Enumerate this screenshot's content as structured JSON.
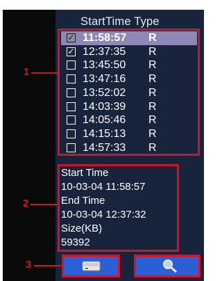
{
  "header": {
    "col_start": "StartTime",
    "col_type": "Type"
  },
  "files": [
    {
      "time": "11:58:57",
      "type": "R",
      "checked": true,
      "selected": true
    },
    {
      "time": "12:37:35",
      "type": "R",
      "checked": true,
      "selected": false
    },
    {
      "time": "13:45:50",
      "type": "R",
      "checked": false,
      "selected": false
    },
    {
      "time": "13:47:16",
      "type": "R",
      "checked": false,
      "selected": false
    },
    {
      "time": "13:52:02",
      "type": "R",
      "checked": false,
      "selected": false
    },
    {
      "time": "14:03:39",
      "type": "R",
      "checked": false,
      "selected": false
    },
    {
      "time": "14:05:46",
      "type": "R",
      "checked": false,
      "selected": false
    },
    {
      "time": "14:15:13",
      "type": "R",
      "checked": false,
      "selected": false
    },
    {
      "time": "14:57:33",
      "type": "R",
      "checked": false,
      "selected": false
    }
  ],
  "info": {
    "start_label": "Start Time",
    "start_value": "10-03-04 11:58:57",
    "end_label": "End Time",
    "end_value": "10-03-04 12:37:32",
    "size_label": "Size(KB)",
    "size_value": "59392"
  },
  "callouts": {
    "one": "1",
    "two": "2",
    "three": "3"
  },
  "buttons": {
    "save_icon": "hard-drive-icon",
    "search_icon": "magnifier-icon"
  },
  "colors": {
    "panel": "#17243c",
    "highlight": "#8e88b6",
    "annotation": "#d0142a",
    "button": "#2a5fd6"
  }
}
